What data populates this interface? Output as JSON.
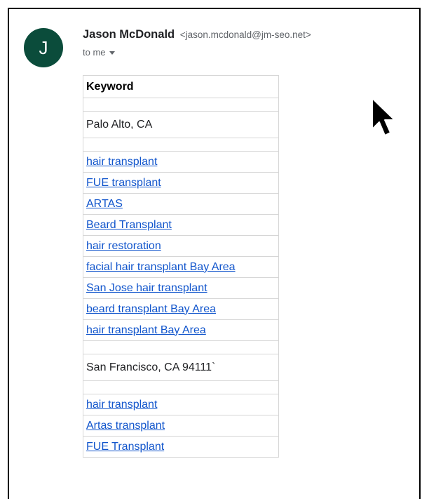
{
  "email": {
    "avatar_letter": "J",
    "avatar_color": "#0b4c3b",
    "sender_name": "Jason McDonald",
    "sender_email": "<jason.mcdonald@jm-seo.net>",
    "to_label": "to me"
  },
  "table": {
    "header": "Keyword",
    "rows": [
      {
        "type": "spacer",
        "text": ""
      },
      {
        "type": "location",
        "text": "Palo Alto, CA"
      },
      {
        "type": "spacer",
        "text": ""
      },
      {
        "type": "link",
        "text": "hair transplant"
      },
      {
        "type": "link",
        "text": "FUE transplant"
      },
      {
        "type": "link",
        "text": "ARTAS"
      },
      {
        "type": "link",
        "text": "Beard Transplant"
      },
      {
        "type": "link",
        "text": "hair restoration"
      },
      {
        "type": "link",
        "text": "facial hair transplant Bay Area"
      },
      {
        "type": "link",
        "text": "San Jose hair transplant"
      },
      {
        "type": "link",
        "text": "beard transplant Bay Area"
      },
      {
        "type": "link",
        "text": "hair transplant Bay Area"
      },
      {
        "type": "spacer",
        "text": ""
      },
      {
        "type": "location",
        "text": "San Francisco, CA 94111`"
      },
      {
        "type": "spacer",
        "text": ""
      },
      {
        "type": "link",
        "text": "hair transplant"
      },
      {
        "type": "link",
        "text": "Artas transplant"
      },
      {
        "type": "link",
        "text": "FUE Transplant"
      }
    ]
  },
  "link_color": "#1155cc"
}
